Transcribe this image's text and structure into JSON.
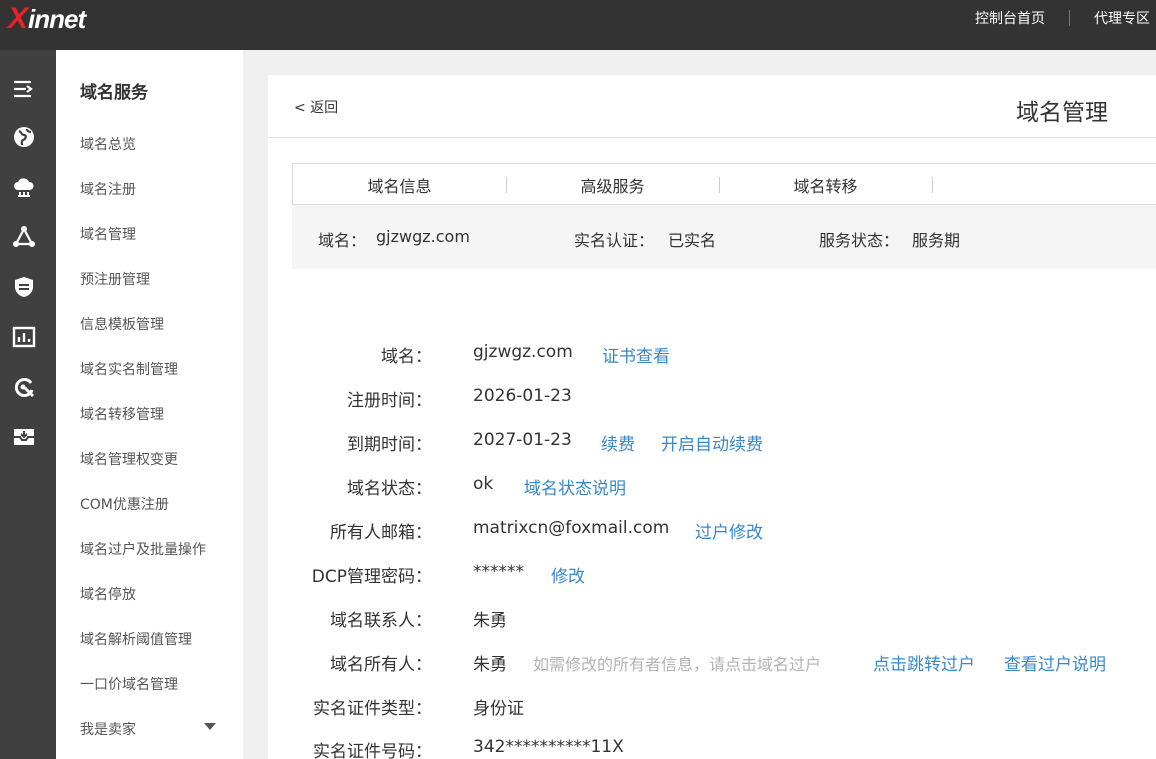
{
  "header": {
    "logo_x": "X",
    "logo_rest": "innet",
    "links": [
      "控制台首页",
      "代理专区"
    ]
  },
  "rail": {
    "icons": [
      "menu-toggle-icon",
      "globe-icon",
      "cloud-icon",
      "network-icon",
      "shield-icon",
      "chart-icon",
      "refresh-icon",
      "mail-icon"
    ]
  },
  "sidebar": {
    "title": "域名服务",
    "items": [
      "域名总览",
      "域名注册",
      "域名管理",
      "预注册管理",
      "信息模板管理",
      "域名实名制管理",
      "域名转移管理",
      "域名管理权变更",
      "COM优惠注册",
      "域名过户及批量操作",
      "域名停放",
      "域名解析阈值管理",
      "一口价域名管理",
      "我是卖家"
    ]
  },
  "main": {
    "back": "< 返回",
    "title": "域名管理",
    "tabs": [
      "域名信息",
      "高级服务",
      "域名转移"
    ],
    "summary": {
      "domain_label": "域名：",
      "domain_value": "gjzwgz.com",
      "verify_label": "实名认证：",
      "verify_value": "已实名",
      "status_label": "服务状态：",
      "status_value": "服务期"
    },
    "details": [
      {
        "label": "域名：",
        "value": "gjzwgz.com",
        "links": [
          "证书查看"
        ]
      },
      {
        "label": "注册时间：",
        "value": "2026-01-23",
        "links": []
      },
      {
        "label": "到期时间：",
        "value": "2027-01-23",
        "links": [
          "续费",
          "开启自动续费"
        ]
      },
      {
        "label": "域名状态：",
        "value": "ok",
        "links": [
          "域名状态说明"
        ]
      },
      {
        "label": "所有人邮箱：",
        "value": "matrixcn@foxmail.com",
        "links": [
          "过户修改"
        ]
      },
      {
        "label": "DCP管理密码：",
        "value": "******",
        "links": [
          "修改"
        ]
      },
      {
        "label": "域名联系人：",
        "value": "朱勇",
        "links": []
      },
      {
        "label": "域名所有人：",
        "value": "朱勇",
        "hint": "如需修改的所有者信息，请点击域名过户",
        "links": [
          "点击跳转过户",
          "查看过户说明"
        ]
      },
      {
        "label": "实名证件类型：",
        "value": "身份证",
        "links": []
      },
      {
        "label": "实名证件号码：",
        "value": "342**********11X",
        "links": []
      }
    ]
  }
}
